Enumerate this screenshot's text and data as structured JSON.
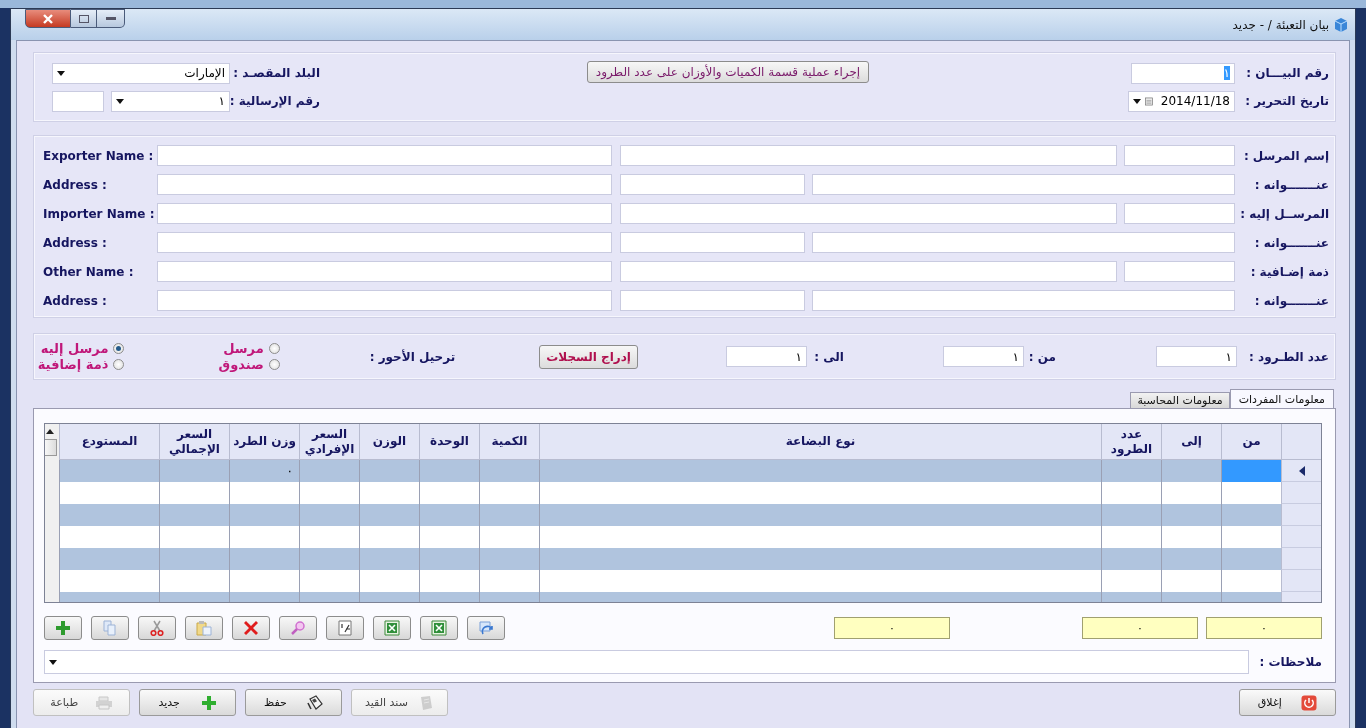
{
  "window": {
    "title": "بيان التعبئة / - جديد"
  },
  "header": {
    "statement_no": {
      "label": "رقم البيـــان :",
      "value": "١",
      "text_selected": true
    },
    "issue_date": {
      "label": "تاريخ التحرير :",
      "value": "2014/11/18"
    },
    "split_button": "إجراء عملية قسمة الكميات والأوزان على عدد الطرود",
    "destination": {
      "label": "البلد المقصـد :",
      "value": "الإمارات"
    },
    "shipment_no": {
      "label": "رقم الإرسالية :",
      "value": "١"
    }
  },
  "parties": [
    {
      "kind": "name",
      "label": "إسم المرسل :",
      "english_label": "Exporter Name :"
    },
    {
      "kind": "address",
      "label": "عنـــــــوانه :",
      "english_label": "Address :"
    },
    {
      "kind": "name",
      "label": "المرســل إليه :",
      "english_label": "Importer Name :"
    },
    {
      "kind": "address",
      "label": "عنـــــــوانه :",
      "english_label": "Address :"
    },
    {
      "kind": "name",
      "label": "ذمة إضـافية :",
      "english_label": "Other Name :"
    },
    {
      "kind": "address",
      "label": "عنـــــــوانه :",
      "english_label": "Address :"
    }
  ],
  "packages": {
    "count": {
      "label": "عدد الطـرود :",
      "value": "١"
    },
    "from": {
      "label": "من :",
      "value": "١"
    },
    "to": {
      "label": "الى :",
      "value": "١"
    },
    "insert_button": "إدراج السجلات",
    "freight_label": "ترحيل الأحور :",
    "options": [
      {
        "label": "مرسل",
        "selected": false
      },
      {
        "label": "مرسل إليه",
        "selected": true
      },
      {
        "label": "صندوق",
        "selected": false
      },
      {
        "label": "ذمة إضافية",
        "selected": false
      }
    ]
  },
  "tabs": [
    {
      "label": "معلومات المفردات",
      "selected": true
    },
    {
      "label": "معلومات المحاسبة",
      "selected": false
    }
  ],
  "grid": {
    "columns": [
      "من",
      "إلى",
      "عدد الطرود",
      "نوع البضاعة",
      "الكمية",
      "الوحدة",
      "الوزن",
      "السعر الإفرادي",
      "وزن الطرد",
      "السعر الإجمالي",
      "المستودع"
    ],
    "rows": [
      {
        "current": true,
        "package_weight": "٠"
      },
      {
        "current": false
      },
      {
        "current": false
      },
      {
        "current": false
      },
      {
        "current": false
      },
      {
        "current": false
      },
      {
        "current": false
      }
    ]
  },
  "toolbar": [
    {
      "kind": "add"
    },
    {
      "kind": "copy"
    },
    {
      "kind": "cut"
    },
    {
      "kind": "paste"
    },
    {
      "kind": "delete"
    },
    {
      "kind": "search"
    },
    {
      "kind": "numbering"
    },
    {
      "kind": "excel"
    },
    {
      "kind": "excel"
    },
    {
      "kind": "refresh"
    }
  ],
  "totals": [
    "٠",
    "٠",
    "٠"
  ],
  "notes": {
    "label": "ملاحظات :"
  },
  "actions": [
    {
      "kind": "close",
      "label": "إغلاق",
      "disabled": false
    },
    {
      "kind": "entry",
      "label": "سند القيد",
      "disabled": true
    },
    {
      "kind": "save",
      "label": "حفظ",
      "disabled": false
    },
    {
      "kind": "new",
      "label": "جديد",
      "disabled": false
    },
    {
      "kind": "print",
      "label": "طباعة",
      "disabled": true
    }
  ]
}
